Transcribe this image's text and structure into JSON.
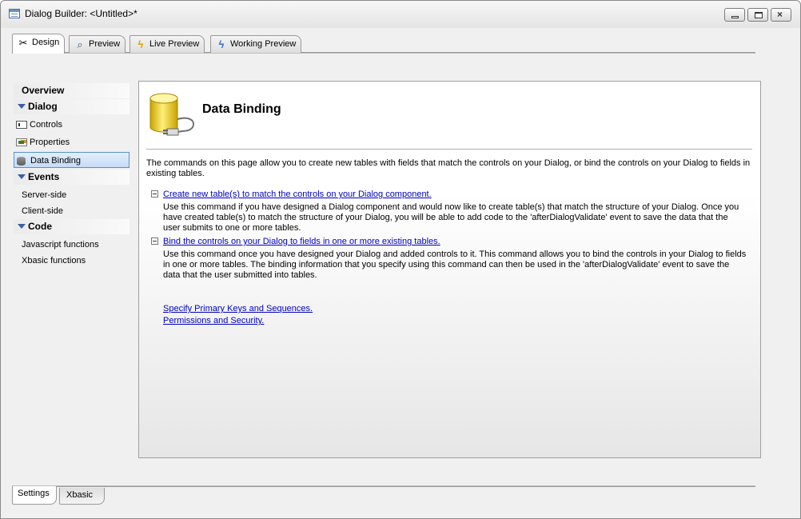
{
  "window": {
    "title": "Dialog Builder: <Untitled>*",
    "controls": {
      "minimize": "minimize",
      "maximize": "maximize",
      "close": "×"
    }
  },
  "top_tabs": [
    {
      "label": "Design",
      "icon": "tools-icon",
      "active": true
    },
    {
      "label": "Preview",
      "icon": "magnifier-icon",
      "active": false
    },
    {
      "label": "Live Preview",
      "icon": "lightning-icon",
      "active": false
    },
    {
      "label": "Working Preview",
      "icon": "lightning-blue-icon",
      "active": false
    }
  ],
  "sidebar": {
    "overview": "Overview",
    "dialog": {
      "header": "Dialog",
      "items": [
        {
          "label": "Controls",
          "icon": "controls-icon"
        },
        {
          "label": "Properties",
          "icon": "properties-icon"
        },
        {
          "label": "Data Binding",
          "icon": "database-icon",
          "selected": true
        }
      ]
    },
    "events": {
      "header": "Events",
      "items": [
        {
          "label": "Server-side"
        },
        {
          "label": "Client-side"
        }
      ]
    },
    "code": {
      "header": "Code",
      "items": [
        {
          "label": "Javascript functions"
        },
        {
          "label": "Xbasic functions"
        }
      ]
    }
  },
  "main": {
    "title": "Data Binding",
    "intro": "The commands on this page allow you to create new tables with fields that match the controls on your Dialog, or bind the controls on your Dialog to fields in existing tables.",
    "commands": [
      {
        "link": "Create new table(s) to match the controls on your Dialog component.",
        "description": "Use this command if you have designed a Dialog component and would now like to create table(s) that match the structure of your Dialog. Once you have created table(s) to match the structure of your Dialog, you will be able to add code to the 'afterDialogValidate' event to save the data that the user submits to one or more tables."
      },
      {
        "link": "Bind the controls on your Dialog to fields in one or more existing tables.",
        "description": "Use this command once you have designed your Dialog and added controls to it. This command allows you to bind the controls in your Dialog to fields in one or more tables. The binding information that you specify using this command can then be used in the 'afterDialogValidate' event to save the data that the user submitted into tables."
      }
    ],
    "links": [
      "Specify Primary Keys and Sequences.",
      "Permissions and Security."
    ]
  },
  "bottom_tabs": [
    {
      "label": "Settings",
      "active": true
    },
    {
      "label": "Xbasic",
      "active": false
    }
  ],
  "colors": {
    "link": "#0000c0",
    "selection": "#c5dcf7",
    "accent": "#3a5ea8"
  }
}
